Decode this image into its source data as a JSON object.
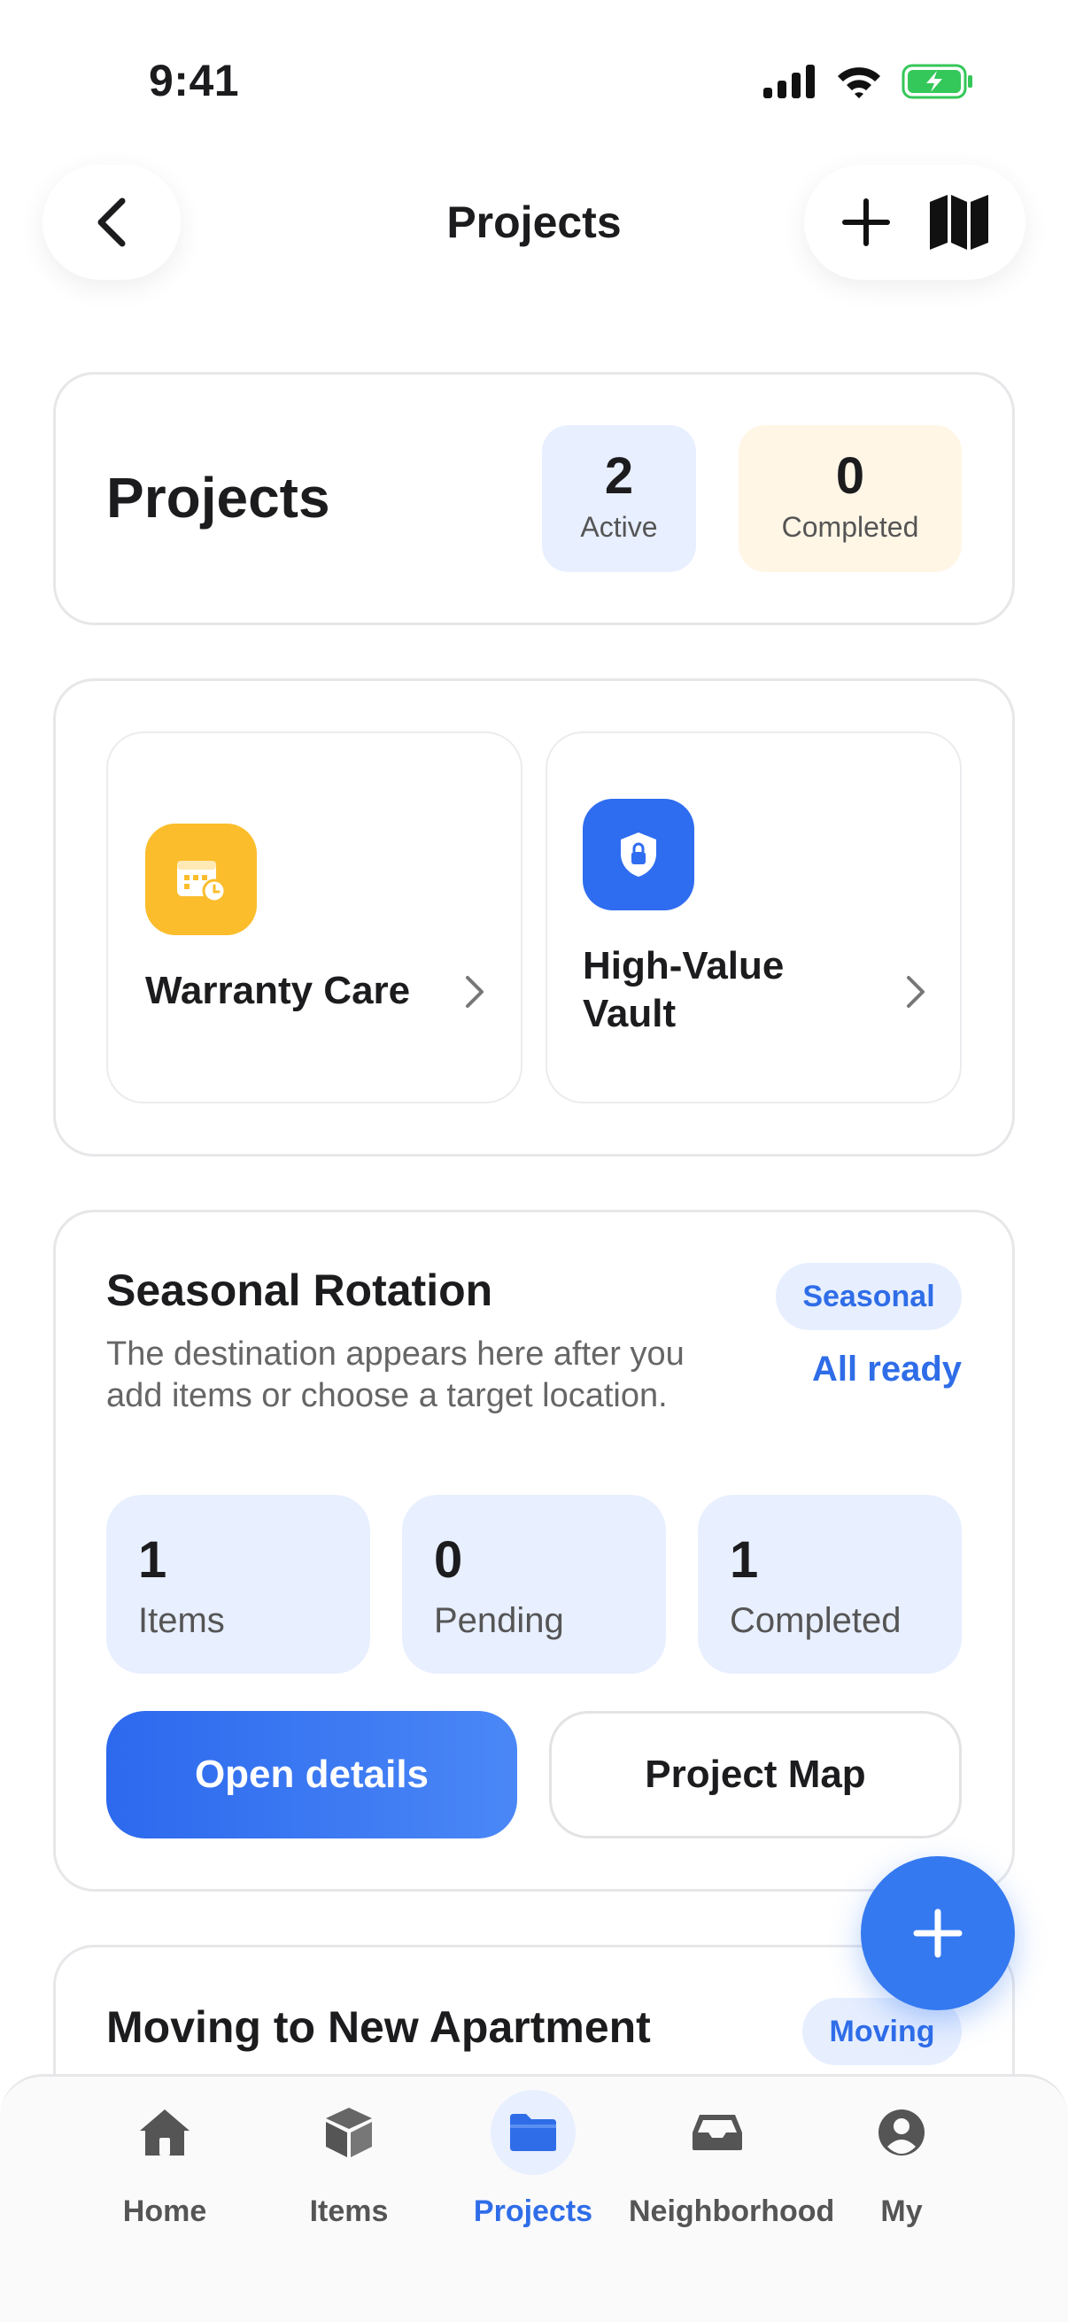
{
  "status_bar": {
    "time": "9:41"
  },
  "nav": {
    "title": "Projects"
  },
  "summary": {
    "title": "Projects",
    "active_count": "2",
    "active_label": "Active",
    "completed_count": "0",
    "completed_label": "Completed"
  },
  "shortcuts": [
    {
      "label": "Warranty Care",
      "icon": "calendar-clock-icon",
      "color": "#FBBD2C"
    },
    {
      "label_line1": "High-Value",
      "label_line2": "Vault",
      "icon": "shield-lock-icon",
      "color": "#2F6DF0"
    }
  ],
  "project_card": {
    "title": "Seasonal Rotation",
    "tag": "Seasonal",
    "status": "All ready",
    "description": "The destination appears here after you add items or choose a target location.",
    "stats": [
      {
        "value": "1",
        "label": "Items"
      },
      {
        "value": "0",
        "label": "Pending"
      },
      {
        "value": "1",
        "label": "Completed"
      }
    ],
    "primary_button": "Open details",
    "secondary_button": "Project Map"
  },
  "next_card": {
    "title": "Moving to New Apartment",
    "tag": "Moving"
  },
  "tabs": [
    {
      "label": "Home",
      "icon": "home-icon"
    },
    {
      "label": "Items",
      "icon": "box-icon"
    },
    {
      "label": "Projects",
      "icon": "folder-icon",
      "active": true
    },
    {
      "label": "Neighborhood",
      "icon": "inbox-icon"
    },
    {
      "label": "My",
      "icon": "person-icon"
    }
  ],
  "colors": {
    "accent": "#2F6DE8",
    "active_bg": "#E8EFFF",
    "completed_bg": "#FFF6E6"
  }
}
